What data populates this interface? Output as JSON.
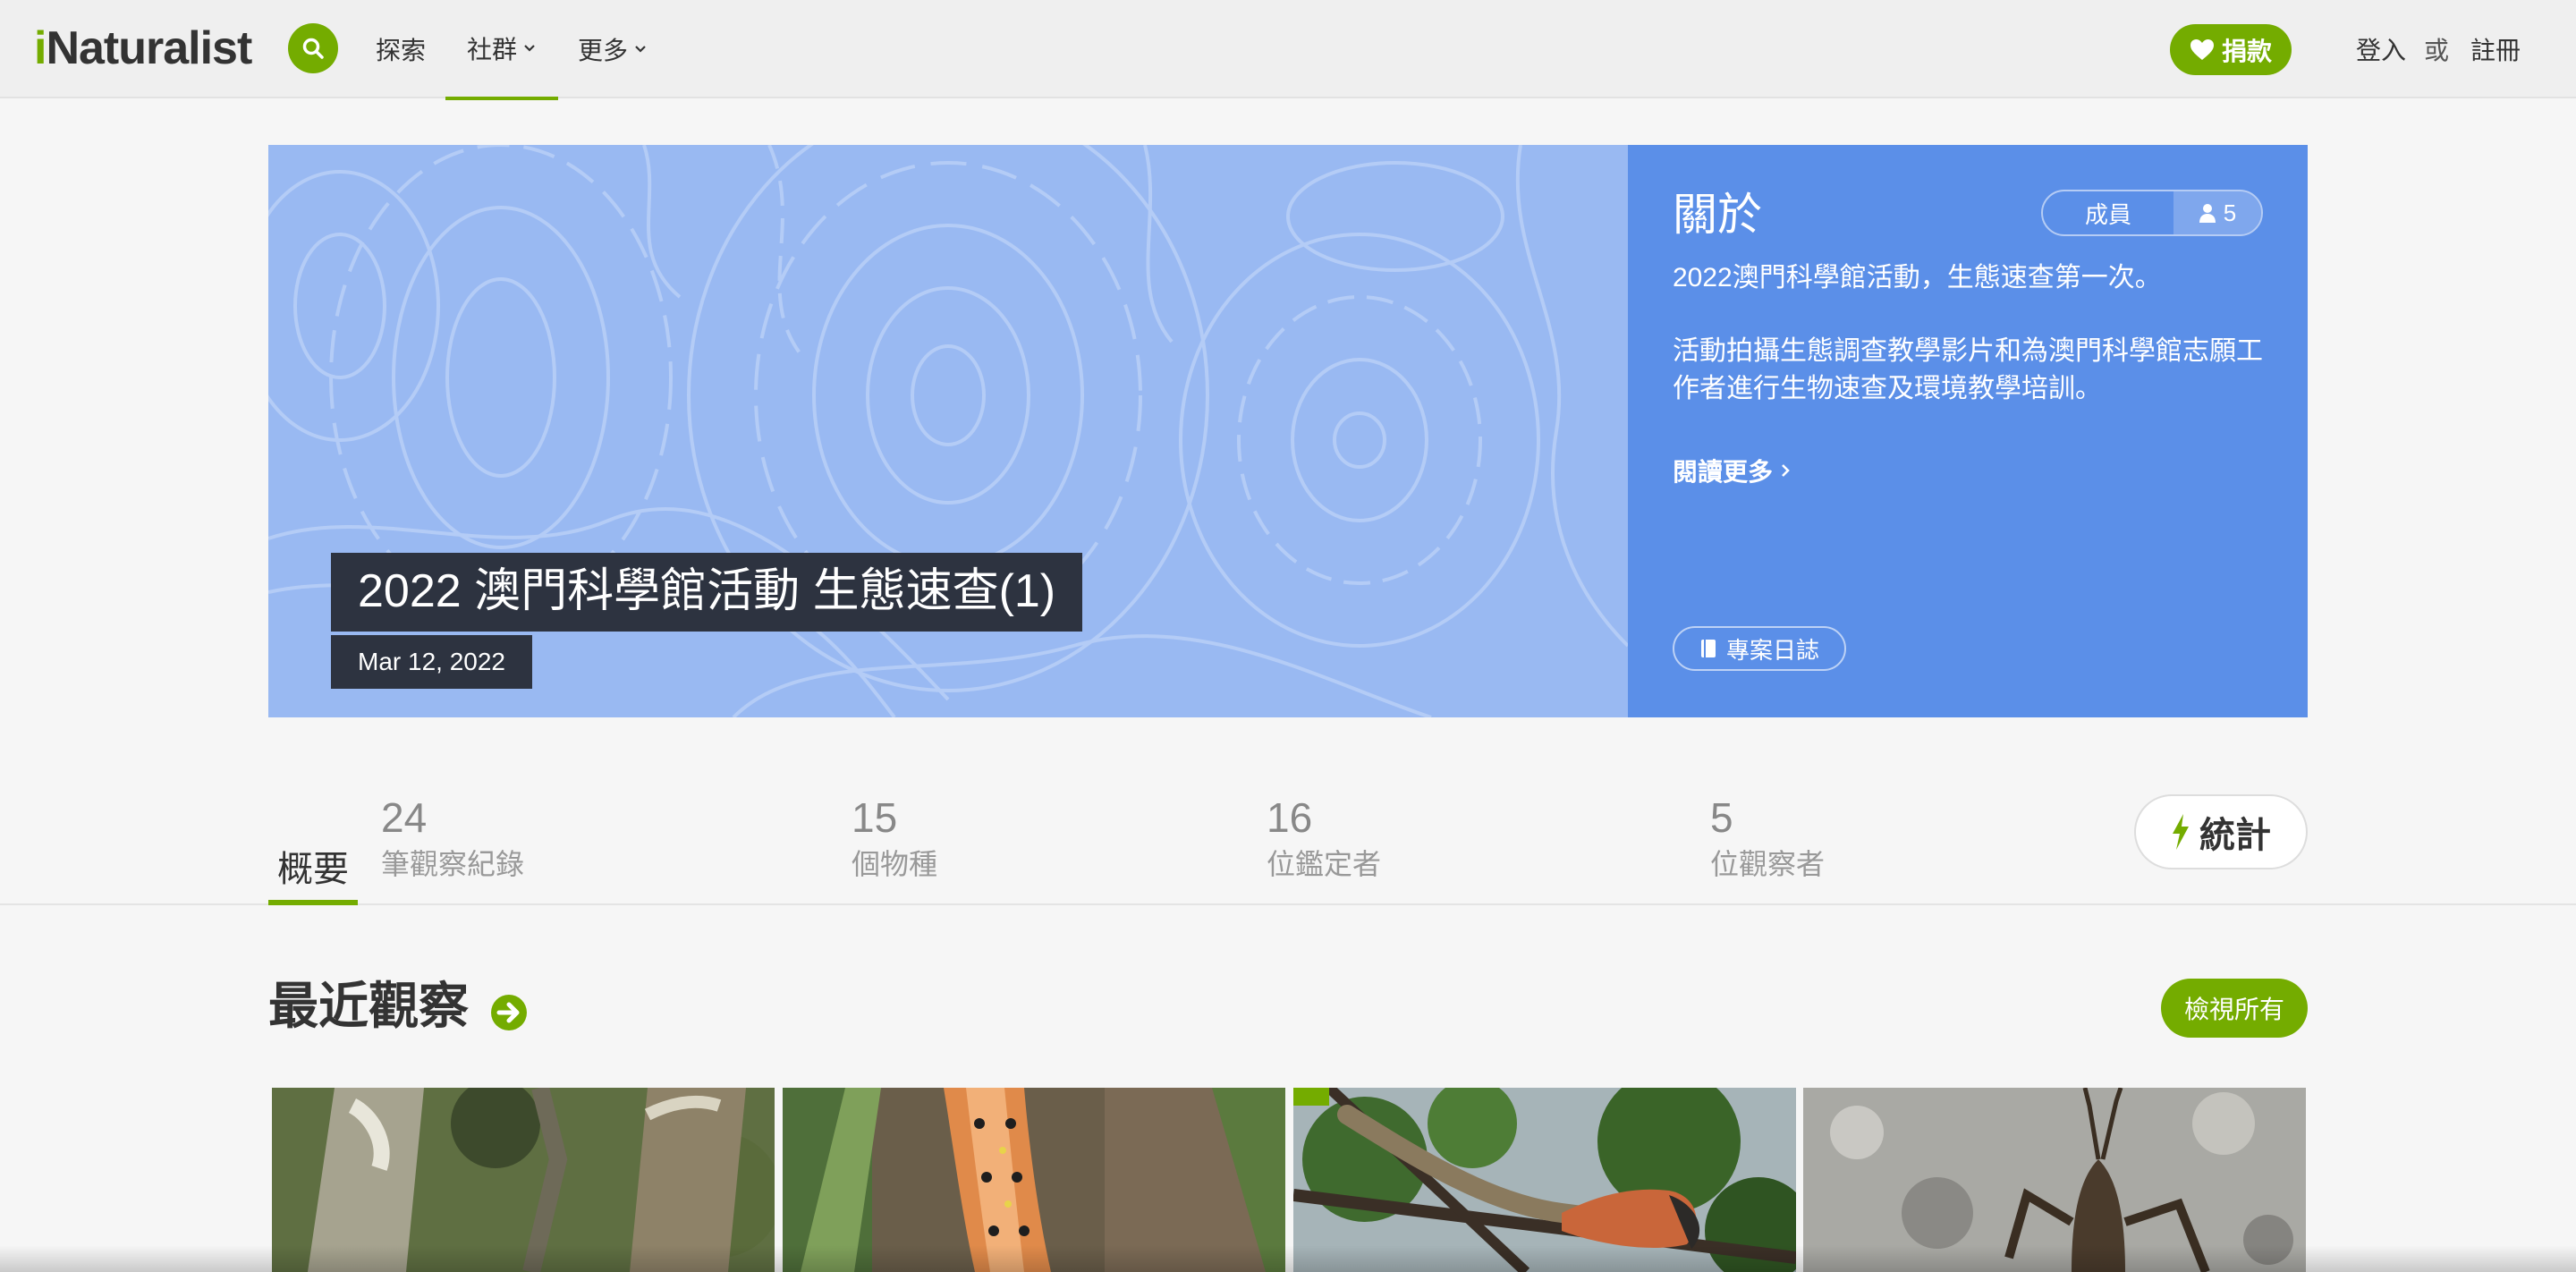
{
  "header": {
    "logo_i": "i",
    "logo_rest": "Naturalist",
    "nav": [
      {
        "label": "探索"
      },
      {
        "label": "社群"
      },
      {
        "label": "更多"
      }
    ],
    "donate_label": "捐款",
    "login_label": "登入",
    "or_label": "或",
    "signup_label": "註冊"
  },
  "banner": {
    "title": "2022 澳門科學館活動 生態速查(1)",
    "date": "Mar 12, 2022"
  },
  "about": {
    "title": "關於",
    "members_label": "成員",
    "members_count": "5",
    "desc_1": "2022澳門科學館活動，生態速查第一次。",
    "desc_2": "活動拍攝生態調查教學影片和為澳門科學館志願工作者進行生物速查及環境教學培訓。",
    "read_more": "閱讀更多",
    "journal": "專案日誌"
  },
  "stats": {
    "overview_tab": "概要",
    "items": [
      {
        "num": "24",
        "label": "筆觀察紀錄"
      },
      {
        "num": "15",
        "label": "個物種"
      },
      {
        "num": "16",
        "label": "位鑑定者"
      },
      {
        "num": "5",
        "label": "位觀察者"
      }
    ],
    "stats_button": "統計"
  },
  "recent": {
    "title": "最近觀察",
    "view_all": "檢視所有",
    "photos": [
      {
        "subject": "tree-trunks"
      },
      {
        "subject": "orange-caterpillar"
      },
      {
        "subject": "lizard-on-branch"
      },
      {
        "subject": "grasshopper-on-concrete"
      }
    ]
  },
  "colors": {
    "brand_green": "#74ac00",
    "banner_blue": "#99b9f2",
    "about_blue": "#5b8fe8",
    "title_box": "#2d3340"
  }
}
